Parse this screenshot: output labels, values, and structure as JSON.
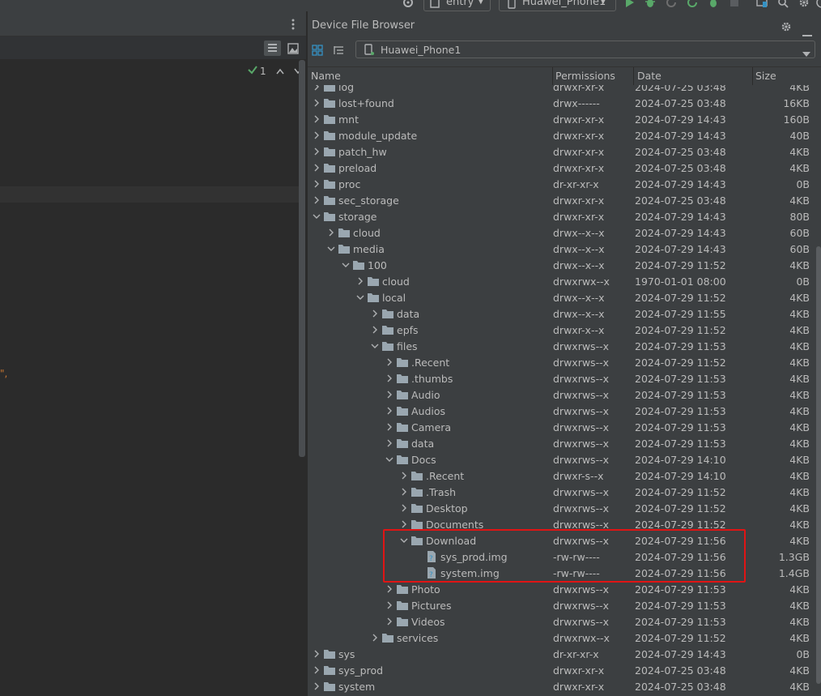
{
  "toolbar": {
    "module": "entry",
    "device": "Huawei_Phone1"
  },
  "left_panel": {
    "inspection_count": "1",
    "code_fragment": "\","
  },
  "panel": {
    "title": "Device File Browser",
    "device": "Huawei_Phone1"
  },
  "columns": {
    "name": "Name",
    "permissions": "Permissions",
    "date": "Date",
    "size": "Size"
  },
  "rows": [
    {
      "name": "log",
      "perm": "drwxr-xr-x",
      "date": "2024-07-25 03:48",
      "size": "4KB",
      "level": 0,
      "type": "dir",
      "expanded": false
    },
    {
      "name": "lost+found",
      "perm": "drwx------",
      "date": "2024-07-25 03:48",
      "size": "16KB",
      "level": 0,
      "type": "dir",
      "expanded": false
    },
    {
      "name": "mnt",
      "perm": "drwxr-xr-x",
      "date": "2024-07-29 14:43",
      "size": "160B",
      "level": 0,
      "type": "dir",
      "expanded": false
    },
    {
      "name": "module_update",
      "perm": "drwxr-xr-x",
      "date": "2024-07-29 14:43",
      "size": "40B",
      "level": 0,
      "type": "dir",
      "expanded": false
    },
    {
      "name": "patch_hw",
      "perm": "drwxr-xr-x",
      "date": "2024-07-25 03:48",
      "size": "4KB",
      "level": 0,
      "type": "dir",
      "expanded": false
    },
    {
      "name": "preload",
      "perm": "drwxr-xr-x",
      "date": "2024-07-25 03:48",
      "size": "4KB",
      "level": 0,
      "type": "dir",
      "expanded": false
    },
    {
      "name": "proc",
      "perm": "dr-xr-xr-x",
      "date": "2024-07-29 14:43",
      "size": "0B",
      "level": 0,
      "type": "dir",
      "expanded": false
    },
    {
      "name": "sec_storage",
      "perm": "drwxr-xr-x",
      "date": "2024-07-25 03:48",
      "size": "4KB",
      "level": 0,
      "type": "dir",
      "expanded": false
    },
    {
      "name": "storage",
      "perm": "drwxr-xr-x",
      "date": "2024-07-29 14:43",
      "size": "80B",
      "level": 0,
      "type": "dir",
      "expanded": true
    },
    {
      "name": "cloud",
      "perm": "drwx--x--x",
      "date": "2024-07-29 14:43",
      "size": "60B",
      "level": 1,
      "type": "dir",
      "expanded": false
    },
    {
      "name": "media",
      "perm": "drwx--x--x",
      "date": "2024-07-29 14:43",
      "size": "60B",
      "level": 1,
      "type": "dir",
      "expanded": true
    },
    {
      "name": "100",
      "perm": "drwx--x--x",
      "date": "2024-07-29 11:52",
      "size": "4KB",
      "level": 2,
      "type": "dir",
      "expanded": true
    },
    {
      "name": "cloud",
      "perm": "drwxrwx--x",
      "date": "1970-01-01 08:00",
      "size": "0B",
      "level": 3,
      "type": "dir",
      "expanded": false
    },
    {
      "name": "local",
      "perm": "drwx--x--x",
      "date": "2024-07-29 11:52",
      "size": "4KB",
      "level": 3,
      "type": "dir",
      "expanded": true
    },
    {
      "name": "data",
      "perm": "drwx--x--x",
      "date": "2024-07-29 11:55",
      "size": "4KB",
      "level": 4,
      "type": "dir",
      "expanded": false
    },
    {
      "name": "epfs",
      "perm": "drwxr-x--x",
      "date": "2024-07-29 11:52",
      "size": "4KB",
      "level": 4,
      "type": "dir",
      "expanded": false
    },
    {
      "name": "files",
      "perm": "drwxrws--x",
      "date": "2024-07-29 11:53",
      "size": "4KB",
      "level": 4,
      "type": "dir",
      "expanded": true
    },
    {
      "name": ".Recent",
      "perm": "drwxrws--x",
      "date": "2024-07-29 11:52",
      "size": "4KB",
      "level": 5,
      "type": "dir",
      "expanded": false
    },
    {
      "name": ".thumbs",
      "perm": "drwxrws--x",
      "date": "2024-07-29 11:53",
      "size": "4KB",
      "level": 5,
      "type": "dir",
      "expanded": false
    },
    {
      "name": "Audio",
      "perm": "drwxrws--x",
      "date": "2024-07-29 11:53",
      "size": "4KB",
      "level": 5,
      "type": "dir",
      "expanded": false
    },
    {
      "name": "Audios",
      "perm": "drwxrws--x",
      "date": "2024-07-29 11:53",
      "size": "4KB",
      "level": 5,
      "type": "dir",
      "expanded": false
    },
    {
      "name": "Camera",
      "perm": "drwxrws--x",
      "date": "2024-07-29 11:53",
      "size": "4KB",
      "level": 5,
      "type": "dir",
      "expanded": false
    },
    {
      "name": "data",
      "perm": "drwxrws--x",
      "date": "2024-07-29 11:53",
      "size": "4KB",
      "level": 5,
      "type": "dir",
      "expanded": false
    },
    {
      "name": "Docs",
      "perm": "drwxrws--x",
      "date": "2024-07-29 14:10",
      "size": "4KB",
      "level": 5,
      "type": "dir",
      "expanded": true
    },
    {
      "name": ".Recent",
      "perm": "drwxr-s--x",
      "date": "2024-07-29 14:10",
      "size": "4KB",
      "level": 6,
      "type": "dir",
      "expanded": false
    },
    {
      "name": ".Trash",
      "perm": "drwxrws--x",
      "date": "2024-07-29 11:52",
      "size": "4KB",
      "level": 6,
      "type": "dir",
      "expanded": false
    },
    {
      "name": "Desktop",
      "perm": "drwxrws--x",
      "date": "2024-07-29 11:52",
      "size": "4KB",
      "level": 6,
      "type": "dir",
      "expanded": false
    },
    {
      "name": "Documents",
      "perm": "drwxrws--x",
      "date": "2024-07-29 11:52",
      "size": "4KB",
      "level": 6,
      "type": "dir",
      "expanded": false
    },
    {
      "name": "Download",
      "perm": "drwxrws--x",
      "date": "2024-07-29 11:56",
      "size": "4KB",
      "level": 6,
      "type": "dir",
      "expanded": true
    },
    {
      "name": "sys_prod.img",
      "perm": "-rw-rw----",
      "date": "2024-07-29 11:56",
      "size": "1.3GB",
      "level": 7,
      "type": "file",
      "expanded": false
    },
    {
      "name": "system.img",
      "perm": "-rw-rw----",
      "date": "2024-07-29 11:56",
      "size": "1.4GB",
      "level": 7,
      "type": "file",
      "expanded": false
    },
    {
      "name": "Photo",
      "perm": "drwxrws--x",
      "date": "2024-07-29 11:53",
      "size": "4KB",
      "level": 5,
      "type": "dir",
      "expanded": false
    },
    {
      "name": "Pictures",
      "perm": "drwxrws--x",
      "date": "2024-07-29 11:53",
      "size": "4KB",
      "level": 5,
      "type": "dir",
      "expanded": false
    },
    {
      "name": "Videos",
      "perm": "drwxrws--x",
      "date": "2024-07-29 11:53",
      "size": "4KB",
      "level": 5,
      "type": "dir",
      "expanded": false
    },
    {
      "name": "services",
      "perm": "drwxrwx--x",
      "date": "2024-07-29 11:52",
      "size": "4KB",
      "level": 4,
      "type": "dir",
      "expanded": false
    },
    {
      "name": "sys",
      "perm": "dr-xr-xr-x",
      "date": "2024-07-29 14:43",
      "size": "0B",
      "level": 0,
      "type": "dir",
      "expanded": false
    },
    {
      "name": "sys_prod",
      "perm": "drwxr-xr-x",
      "date": "2024-07-25 03:48",
      "size": "4KB",
      "level": 0,
      "type": "dir",
      "expanded": false
    },
    {
      "name": "system",
      "perm": "drwxr-xr-x",
      "date": "2024-07-25 03:48",
      "size": "4KB",
      "level": 0,
      "type": "dir",
      "expanded": false
    }
  ],
  "colors": {
    "run": "#59a869",
    "debug": "#59a869",
    "folder": "#9aa7b0",
    "highlight_border": "#e01414",
    "checkmark": "#59a869"
  }
}
